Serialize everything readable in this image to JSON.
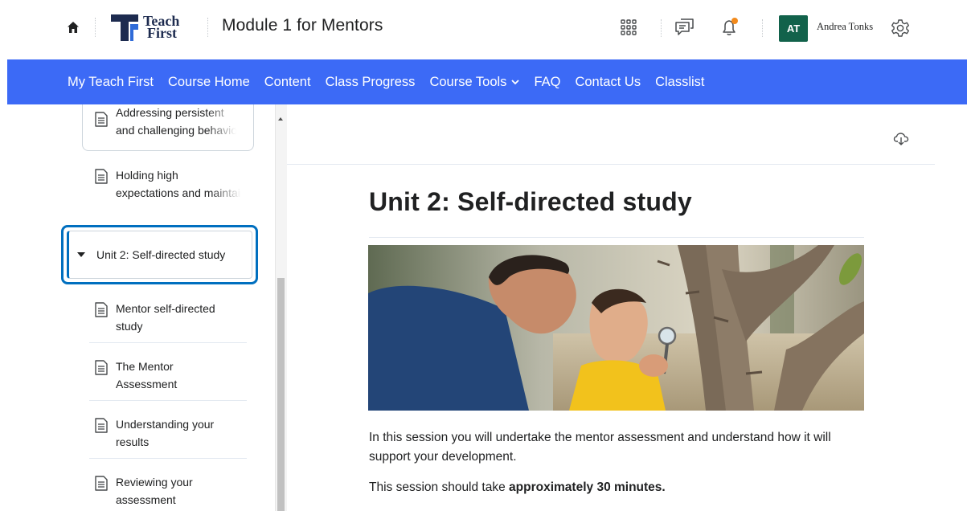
{
  "header": {
    "logo_line1": "Teach",
    "logo_line2": "First",
    "course_title": "Module 1 for Mentors",
    "avatar_initials": "AT",
    "user_name": "Andrea Tonks"
  },
  "nav": {
    "items": [
      "My Teach First",
      "Course Home",
      "Content",
      "Class Progress",
      "Course Tools",
      "FAQ",
      "Contact Us",
      "Classlist"
    ]
  },
  "sidebar": {
    "top_items": [
      {
        "line1": "Addressing persistent",
        "line2": "and challenging behaviour"
      },
      {
        "line1": "Holding high",
        "line2": "expectations and maintaining"
      }
    ],
    "unit_label": "Unit 2: Self-directed study",
    "unit_items": [
      {
        "line1": "Mentor self-directed",
        "line2": "study"
      },
      {
        "line1": "The Mentor",
        "line2": "Assessment"
      },
      {
        "line1": "Understanding your",
        "line2": "results"
      },
      {
        "line1": "Reviewing your",
        "line2": "assessment"
      }
    ]
  },
  "main": {
    "title": "Unit 2: Self-directed study",
    "intro": "In this session you will undertake the mentor assessment and understand how it will support your development.",
    "duration_prefix": "This session should take ",
    "duration_bold": "approximately 30 minutes."
  },
  "colors": {
    "nav_bg": "#3c6af6",
    "focus_ring": "#006fbf",
    "avatar_bg": "#12624b",
    "notification_dot": "#f28a1c",
    "logo_navy": "#1d2b4f",
    "logo_blue": "#2f6bd8"
  }
}
